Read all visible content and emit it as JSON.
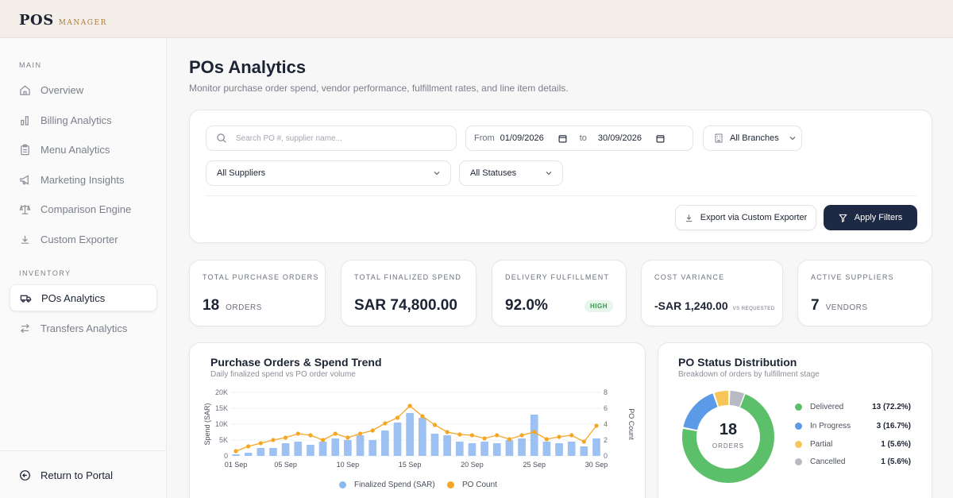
{
  "brand": {
    "name": "POS",
    "sub": "MANAGER"
  },
  "sidebar": {
    "main_label": "MAIN",
    "inventory_label": "INVENTORY",
    "main_items": [
      {
        "label": "Overview",
        "icon": "home-icon"
      },
      {
        "label": "Billing Analytics",
        "icon": "bar-chart-icon"
      },
      {
        "label": "Menu Analytics",
        "icon": "clipboard-icon"
      },
      {
        "label": "Marketing Insights",
        "icon": "megaphone-icon"
      },
      {
        "label": "Comparison Engine",
        "icon": "scale-icon"
      },
      {
        "label": "Custom Exporter",
        "icon": "download-icon"
      }
    ],
    "inventory_items": [
      {
        "label": "POs Analytics",
        "icon": "truck-icon",
        "active": true
      },
      {
        "label": "Transfers Analytics",
        "icon": "transfer-icon"
      }
    ],
    "return_label": "Return to Portal"
  },
  "page": {
    "title": "POs Analytics",
    "subtitle": "Monitor purchase order spend, vendor performance, fulfillment rates, and line item details."
  },
  "filters": {
    "search_placeholder": "Search PO #, supplier name...",
    "from_label": "From",
    "from_date": "01/09/2026",
    "to_label": "to",
    "to_date": "30/09/2026",
    "branch": "All Branches",
    "supplier": "All Suppliers",
    "status": "All Statuses",
    "export_label": "Export via Custom Exporter",
    "apply_label": "Apply Filters"
  },
  "kpis": [
    {
      "label": "TOTAL PURCHASE ORDERS",
      "value": "18",
      "unit": "ORDERS"
    },
    {
      "label": "TOTAL FINALIZED SPEND",
      "value": "SAR 74,800.00",
      "unit": ""
    },
    {
      "label": "DELIVERY FULFILLMENT",
      "value": "92.0%",
      "badge": "HIGH"
    },
    {
      "label": "COST VARIANCE",
      "value": "-SAR 1,240.00",
      "unit": "VS REQUESTED"
    },
    {
      "label": "ACTIVE SUPPLIERS",
      "value": "7",
      "unit": "VENDORS"
    }
  ],
  "colors": {
    "bar": "#9dc1f2",
    "line": "#f5a623",
    "delivered": "#5cbf6a",
    "in_progress": "#5b9ae6",
    "partial": "#f7c65a",
    "cancelled": "#b7bac2",
    "navy": "#1e2a45"
  },
  "trend": {
    "title": "Purchase Orders & Spend Trend",
    "subtitle": "Daily finalized spend vs PO order volume",
    "chart_data": {
      "type": "bar",
      "x": [
        1,
        2,
        3,
        4,
        5,
        6,
        7,
        8,
        9,
        10,
        11,
        12,
        13,
        14,
        15,
        16,
        17,
        18,
        19,
        20,
        21,
        22,
        23,
        24,
        25,
        26,
        27,
        28,
        29,
        30
      ],
      "x_tick_labels": [
        "01 Sep",
        "05 Sep",
        "10 Sep",
        "15 Sep",
        "20 Sep",
        "25 Sep",
        "30 Sep"
      ],
      "x_ticks": [
        1,
        5,
        10,
        15,
        20,
        25,
        30
      ],
      "y_ticks": [
        "0",
        "5K",
        "10K",
        "15K",
        "20K"
      ],
      "y2_ticks": [
        "0",
        "2",
        "4",
        "6",
        "8"
      ],
      "ylabel": "Spend (SAR)",
      "y2label": "PO Count",
      "ylim": [
        0,
        20000
      ],
      "y2lim": [
        0,
        8
      ],
      "series": [
        {
          "name": "Finalized Spend (SAR)",
          "type": "bar",
          "values": [
            500,
            1000,
            2500,
            2500,
            4000,
            4500,
            3500,
            4500,
            5500,
            5000,
            6500,
            5000,
            8000,
            10500,
            13500,
            12000,
            7000,
            6500,
            4500,
            4000,
            4500,
            4000,
            5000,
            5500,
            13000,
            4500,
            4000,
            4500,
            3000,
            5500
          ]
        },
        {
          "name": "PO Count",
          "type": "line",
          "values": [
            0.6,
            1.2,
            1.6,
            2.0,
            2.3,
            2.8,
            2.6,
            2.0,
            2.8,
            2.3,
            2.8,
            3.2,
            4.1,
            4.8,
            6.3,
            5.0,
            3.9,
            3.0,
            2.7,
            2.6,
            2.2,
            2.6,
            2.1,
            2.6,
            3.0,
            2.1,
            2.4,
            2.6,
            1.8,
            3.8
          ]
        }
      ]
    }
  },
  "status": {
    "title": "PO Status Distribution",
    "subtitle": "Breakdown of orders by fulfillment stage",
    "center_value": "18",
    "center_label": "ORDERS",
    "chart_data": {
      "type": "pie",
      "categories": [
        "Delivered",
        "In Progress",
        "Partial",
        "Cancelled"
      ],
      "values": [
        13,
        3,
        1,
        1
      ],
      "value_labels": [
        "13 (72.2%)",
        "3 (16.7%)",
        "1 (5.6%)",
        "1 (5.6%)"
      ]
    }
  }
}
